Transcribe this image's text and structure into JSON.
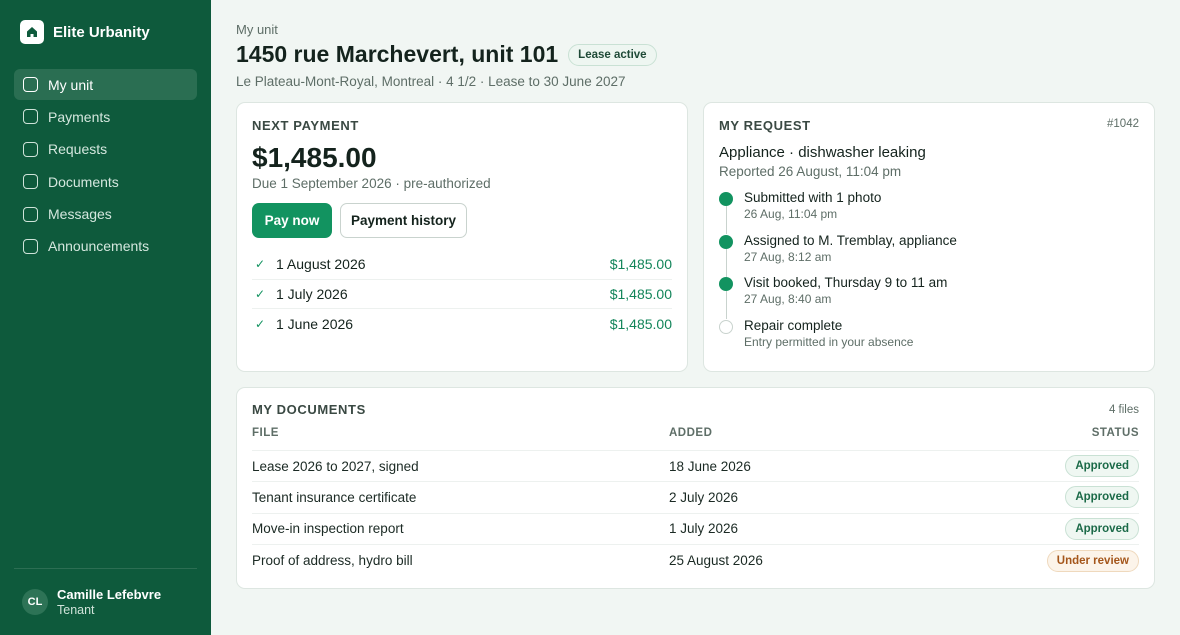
{
  "brand": {
    "name": "Elite Urbanity"
  },
  "nav": {
    "items": [
      {
        "label": "My unit",
        "active": true
      },
      {
        "label": "Payments"
      },
      {
        "label": "Requests"
      },
      {
        "label": "Documents"
      },
      {
        "label": "Messages"
      },
      {
        "label": "Announcements"
      }
    ]
  },
  "user": {
    "initials": "CL",
    "name": "Camille Lefebvre",
    "role": "Tenant"
  },
  "header": {
    "eyebrow": "My unit",
    "title": "1450 rue Marchevert, unit 101",
    "badge": "Lease active",
    "subtitle": "Le Plateau-Mont-Royal, Montreal · 4 1/2 · Lease to 30 June 2027"
  },
  "payment": {
    "heading": "NEXT PAYMENT",
    "amount": "$1,485.00",
    "due": "Due 1 September 2026 · pre-authorized",
    "pay_label": "Pay now",
    "history_label": "Payment history",
    "history": [
      {
        "date": "1 August 2026",
        "amount": "$1,485.00"
      },
      {
        "date": "1 July 2026",
        "amount": "$1,485.00"
      },
      {
        "date": "1 June 2026",
        "amount": "$1,485.00"
      }
    ]
  },
  "request": {
    "heading": "MY REQUEST",
    "id": "#1042",
    "title": "Appliance · dishwasher leaking",
    "reported": "Reported 26 August, 11:04 pm",
    "steps": [
      {
        "title": "Submitted with 1 photo",
        "time": "26 Aug, 11:04 pm",
        "done": true
      },
      {
        "title": "Assigned to M. Tremblay, appliance",
        "time": "27 Aug, 8:12 am",
        "done": true
      },
      {
        "title": "Visit booked, Thursday 9 to 11 am",
        "time": "27 Aug, 8:40 am",
        "done": true
      },
      {
        "title": "Repair complete",
        "time": "Entry permitted in your absence",
        "done": false
      }
    ]
  },
  "documents": {
    "heading": "MY DOCUMENTS",
    "count": "4 files",
    "columns": {
      "file": "FILE",
      "added": "ADDED",
      "status": "STATUS"
    },
    "rows": [
      {
        "file": "Lease 2026 to 2027, signed",
        "added": "18 June 2026",
        "status": "Approved"
      },
      {
        "file": "Tenant insurance certificate",
        "added": "2 July 2026",
        "status": "Approved"
      },
      {
        "file": "Move-in inspection report",
        "added": "1 July 2026",
        "status": "Approved"
      },
      {
        "file": "Proof of address, hydro bill",
        "added": "25 August 2026",
        "status": "Under review"
      }
    ]
  }
}
